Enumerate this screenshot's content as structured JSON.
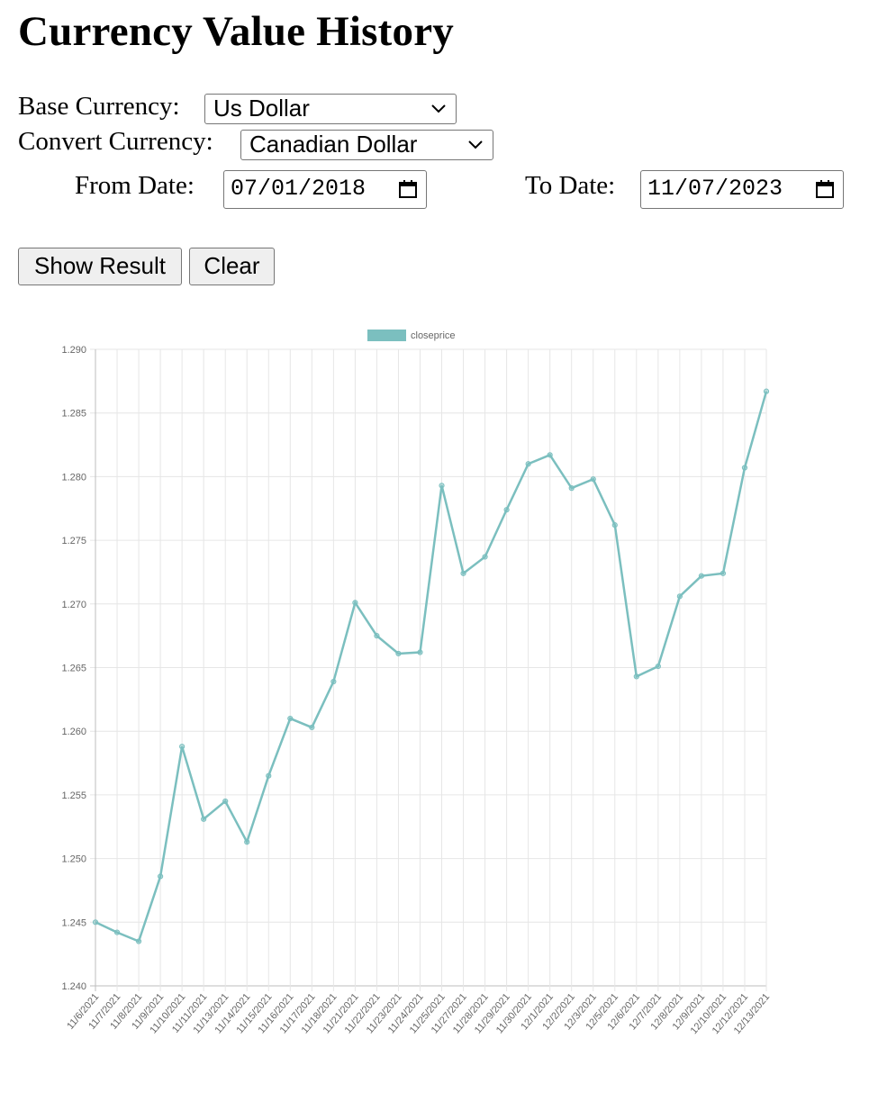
{
  "page": {
    "title": "Currency Value History"
  },
  "form": {
    "base_label": "Base Currency:",
    "base_value": "Us Dollar",
    "convert_label": "Convert Currency:",
    "convert_value": "Canadian Dollar",
    "from_label": "From Date:",
    "from_value": "07/01/2018",
    "to_label": "To Date:",
    "to_value": "11/07/2023",
    "show_button": "Show Result",
    "clear_button": "Clear"
  },
  "colors": {
    "series": "#7bbfbf",
    "grid": "#e6e6e6",
    "axis_text": "#666666"
  },
  "icons": {
    "select_arrow": "chevron-down-icon",
    "date_picker": "calendar-icon"
  },
  "chart_data": {
    "type": "line",
    "legend": "closeprice",
    "legend_position": "top",
    "grid": true,
    "ylim": [
      1.24,
      1.29
    ],
    "yticks": [
      "1.290",
      "1.285",
      "1.280",
      "1.275",
      "1.270",
      "1.265",
      "1.260",
      "1.255",
      "1.250",
      "1.245",
      "1.240"
    ],
    "categories": [
      "11/6/2021",
      "11/7/2021",
      "11/8/2021",
      "11/9/2021",
      "11/10/2021",
      "11/11/2021",
      "11/13/2021",
      "11/14/2021",
      "11/15/2021",
      "11/16/2021",
      "11/17/2021",
      "11/18/2021",
      "11/21/2021",
      "11/22/2021",
      "11/23/2021",
      "11/24/2021",
      "11/25/2021",
      "11/27/2021",
      "11/28/2021",
      "11/29/2021",
      "11/30/2021",
      "12/1/2021",
      "12/2/2021",
      "12/3/2021",
      "12/5/2021",
      "12/6/2021",
      "12/7/2021",
      "12/8/2021",
      "12/9/2021",
      "12/10/2021",
      "12/12/2021",
      "12/13/2021"
    ],
    "series": [
      {
        "name": "closeprice",
        "values": [
          1.245,
          1.2442,
          1.2435,
          1.2486,
          1.2588,
          1.2531,
          1.2545,
          1.2513,
          1.2565,
          1.261,
          1.2603,
          1.2639,
          1.2701,
          1.2675,
          1.2661,
          1.2662,
          1.2793,
          1.2724,
          1.2737,
          1.2774,
          1.281,
          1.2817,
          1.2791,
          1.2798,
          1.2762,
          1.2643,
          1.2651,
          1.2706,
          1.2722,
          1.2724,
          1.2807,
          1.2867
        ]
      }
    ]
  }
}
